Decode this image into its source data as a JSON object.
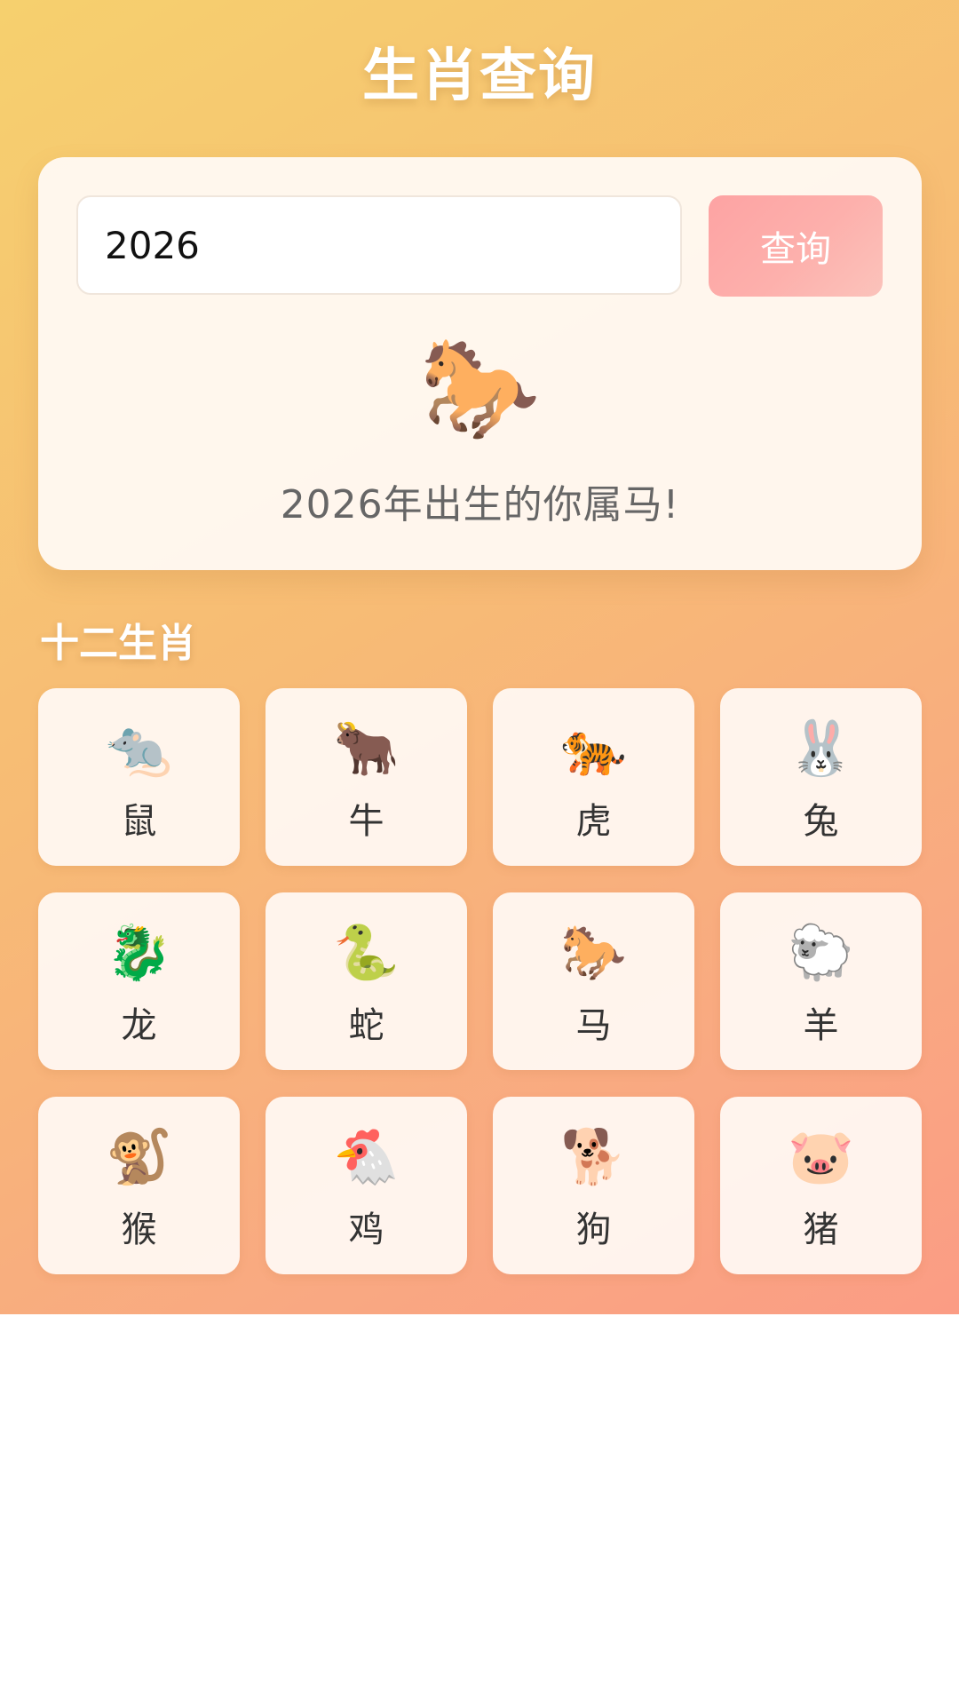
{
  "header": {
    "title": "生肖查询"
  },
  "query": {
    "input_value": "2026",
    "button_label": "查询",
    "result_emoji": "🐎",
    "result_text": "2026年出生的你属马!"
  },
  "zodiac": {
    "section_title": "十二生肖",
    "items": [
      {
        "name": "鼠",
        "emoji": "🐀"
      },
      {
        "name": "牛",
        "emoji": "🐂"
      },
      {
        "name": "虎",
        "emoji": "🐅"
      },
      {
        "name": "兔",
        "emoji": "🐰"
      },
      {
        "name": "龙",
        "emoji": "🐉"
      },
      {
        "name": "蛇",
        "emoji": "🐍"
      },
      {
        "name": "马",
        "emoji": "🐎"
      },
      {
        "name": "羊",
        "emoji": "🐑"
      },
      {
        "name": "猴",
        "emoji": "🐒"
      },
      {
        "name": "鸡",
        "emoji": "🐔"
      },
      {
        "name": "狗",
        "emoji": "🐕"
      },
      {
        "name": "猪",
        "emoji": "🐷"
      }
    ]
  }
}
